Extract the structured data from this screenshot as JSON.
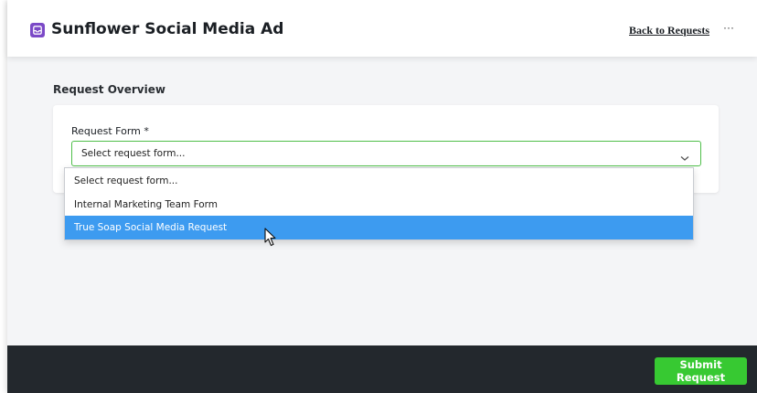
{
  "header": {
    "title": "Sunflower Social Media Ad",
    "back_link": "Back to Requests",
    "more_label": "···",
    "app_icon": "inbox-icon"
  },
  "overview": {
    "section_title": "Request Overview",
    "field_label": "Request Form *",
    "select_value": "Select request form...",
    "options": [
      "Select request form...",
      "Internal Marketing Team Form",
      "True Soap Social Media Request"
    ],
    "highlighted_option_index": 2
  },
  "footer": {
    "submit_label": "Submit Request"
  },
  "colors": {
    "accent_green": "#37c932",
    "highlight_blue": "#3d9bf0",
    "app_icon_purple": "#7b49c7",
    "footer_dark": "#23282d"
  }
}
